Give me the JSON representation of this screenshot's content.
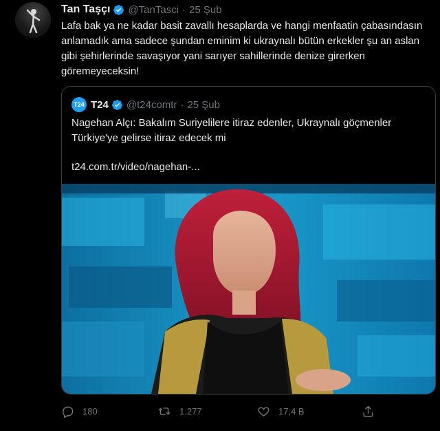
{
  "tweet": {
    "name": "Tan Taşçı",
    "handle": "@TanTasci",
    "separator": "·",
    "date": "25 Şub",
    "text": "Lafa bak ya ne kadar basit zavallı hesaplarda ve hangi menfaatin çabasındasın anlamadık ama sadece şundan eminim ki ukraynalı bütün erkekler şu an aslan gibi şehirlerinde savaşıyor yani sarıyer sahillerinde denize girerken göremeyeceksin!"
  },
  "quote": {
    "logo_text": "T24",
    "name": "T24",
    "handle": "@t24comtr",
    "separator": "·",
    "date": "25 Şub",
    "text": "Nagehan Alçı: Bakalım Suriyelilere itiraz edenler, Ukraynalı göçmenler Türkiye'ye gelirse itiraz edecek mi",
    "link": "t24.com.tr/video/nagehan-..."
  },
  "actions": {
    "replies": "180",
    "retweets": "1.277",
    "likes": "17,4 B"
  },
  "icons": {
    "reply": "reply-icon",
    "retweet": "retweet-icon",
    "like": "heart-icon",
    "share": "share-icon",
    "verified": "verified-icon"
  },
  "colors": {
    "background": "#000000",
    "text": "#e7e9ea",
    "muted": "#71767b",
    "verified": "#1d9bf0"
  }
}
